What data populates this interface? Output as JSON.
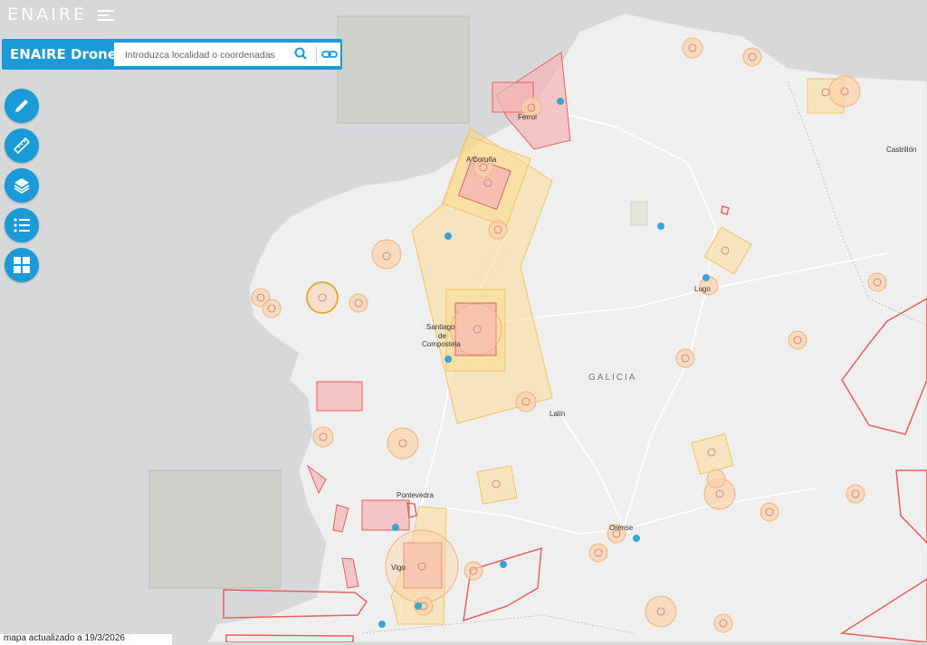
{
  "header": {
    "logo_text": "ENAIRE"
  },
  "search": {
    "brand": "ENAIRE Drones",
    "placeholder": "Introduzca localidad o coordenadas",
    "search_icon": "search-icon",
    "link_icon": "link-icon"
  },
  "tools": [
    {
      "name": "draw-tool",
      "icon": "pencil-icon"
    },
    {
      "name": "measure-tool",
      "icon": "ruler-icon"
    },
    {
      "name": "layers-tool",
      "icon": "layers-icon"
    },
    {
      "name": "legend-tool",
      "icon": "list-icon"
    },
    {
      "name": "apps-tool",
      "icon": "grid-icon"
    }
  ],
  "map": {
    "region_label": "GALICIA",
    "places": {
      "ferrol": "Ferrol",
      "coruna": "A Coruña",
      "castrillon": "Castrillón",
      "lugo": "Lugo",
      "santiago_1": "Santiago",
      "santiago_2": "de",
      "santiago_3": "Compostela",
      "lalin": "Lalín",
      "pontevedra": "Pontevedra",
      "orense": "Orense",
      "vigo": "Vigo"
    },
    "colors": {
      "sea": "#d6d8d9",
      "land": "#f0f0f0",
      "restricted": "#e8615f",
      "caution": "#fcd98a"
    }
  },
  "footer": {
    "updated_text": "mapa actualizado a 19/3/2026"
  }
}
